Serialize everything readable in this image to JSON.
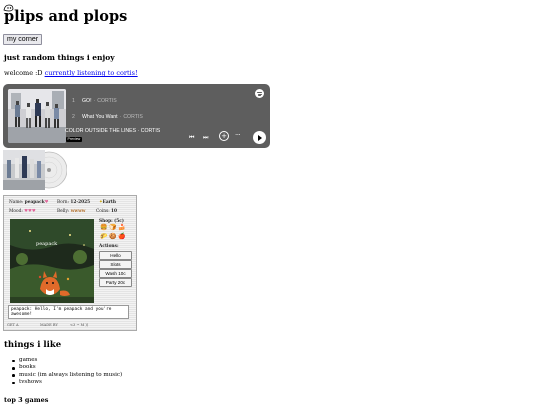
{
  "page": {
    "title": "plips and plops",
    "title_doodle": "doodle-creature-icon",
    "corner_button": "my corner"
  },
  "intro": {
    "heading": "just random things i enjoy",
    "welcome_text": "welcome :D ",
    "welcome_link": "currently listening to cortis!"
  },
  "spotify": {
    "logo": "spotify-logo-icon",
    "tracks": [
      {
        "num": "1",
        "title": "GO!",
        "artist": "CORTIS"
      },
      {
        "num": "2",
        "title": "What You Want",
        "artist": "CORTIS"
      }
    ],
    "now_playing": "COLOR OUTSIDE THE LINES · CORTIS",
    "preview_badge": "Preview",
    "controls": [
      "previous-icon",
      "next-icon",
      "add-icon",
      "more-icon",
      "play-icon"
    ],
    "background_color": "#5e5e5e"
  },
  "pet": {
    "name_label": "Name:",
    "name_value": "peapack",
    "born_label": "Born:",
    "born_value": "12-2025",
    "home_value": "Earth",
    "mood_label": "Mood:",
    "belly_label": "Belly:",
    "belly_value": "wwww",
    "coins_label": "Coins:",
    "coins_value": "10",
    "scene_name": "peapack",
    "shop_label": "Shop: (5c)",
    "actions_label": "Actions:",
    "actions": [
      "Hello",
      "Slots",
      "Wash 10c",
      "Party 20c"
    ],
    "message": "peapack: Hello, I'm peapack and you're awesome!",
    "footer_left": "GET A",
    "footer_mid": "MADE BY",
    "footer_right": "<3 ~ M ))"
  },
  "likes": {
    "heading": "things i like",
    "items": [
      "games",
      "books",
      "music (im always listening to music)",
      "tvshows"
    ]
  },
  "top3": {
    "heading": "top 3 games"
  }
}
